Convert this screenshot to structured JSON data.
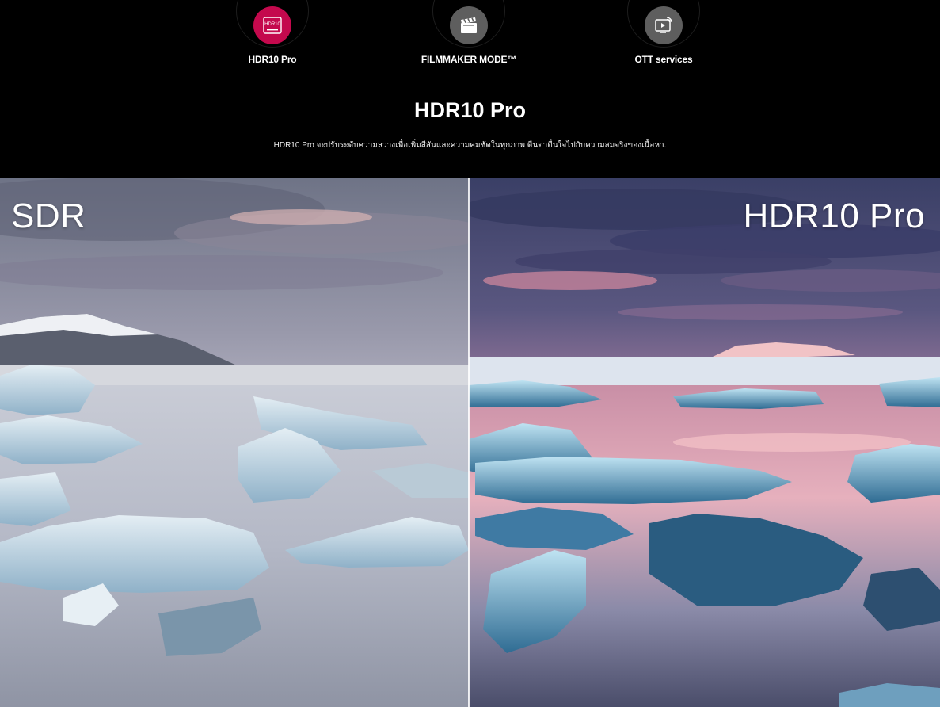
{
  "tabs": [
    {
      "label": "HDR10 Pro",
      "icon": "hdr10-icon",
      "badge": "HDR10",
      "active": true
    },
    {
      "label": "FILMMAKER MODE™",
      "icon": "clapperboard-icon",
      "active": false
    },
    {
      "label": "OTT services",
      "icon": "ott-screen-icon",
      "active": false
    }
  ],
  "section": {
    "title": "HDR10 Pro",
    "description": "HDR10 Pro จะปรับระดับความสว่างเพื่อเพิ่มสีสันและความคมชัดในทุกภาพ ตื่นตาตื่นใจไปกับความสมจริงของเนื้อหา."
  },
  "compare": {
    "left_label": "SDR",
    "right_label": "HDR10 Pro"
  },
  "colors": {
    "accent": "#c4094d",
    "icon_grey": "#5e5e5e",
    "background": "#000000"
  }
}
